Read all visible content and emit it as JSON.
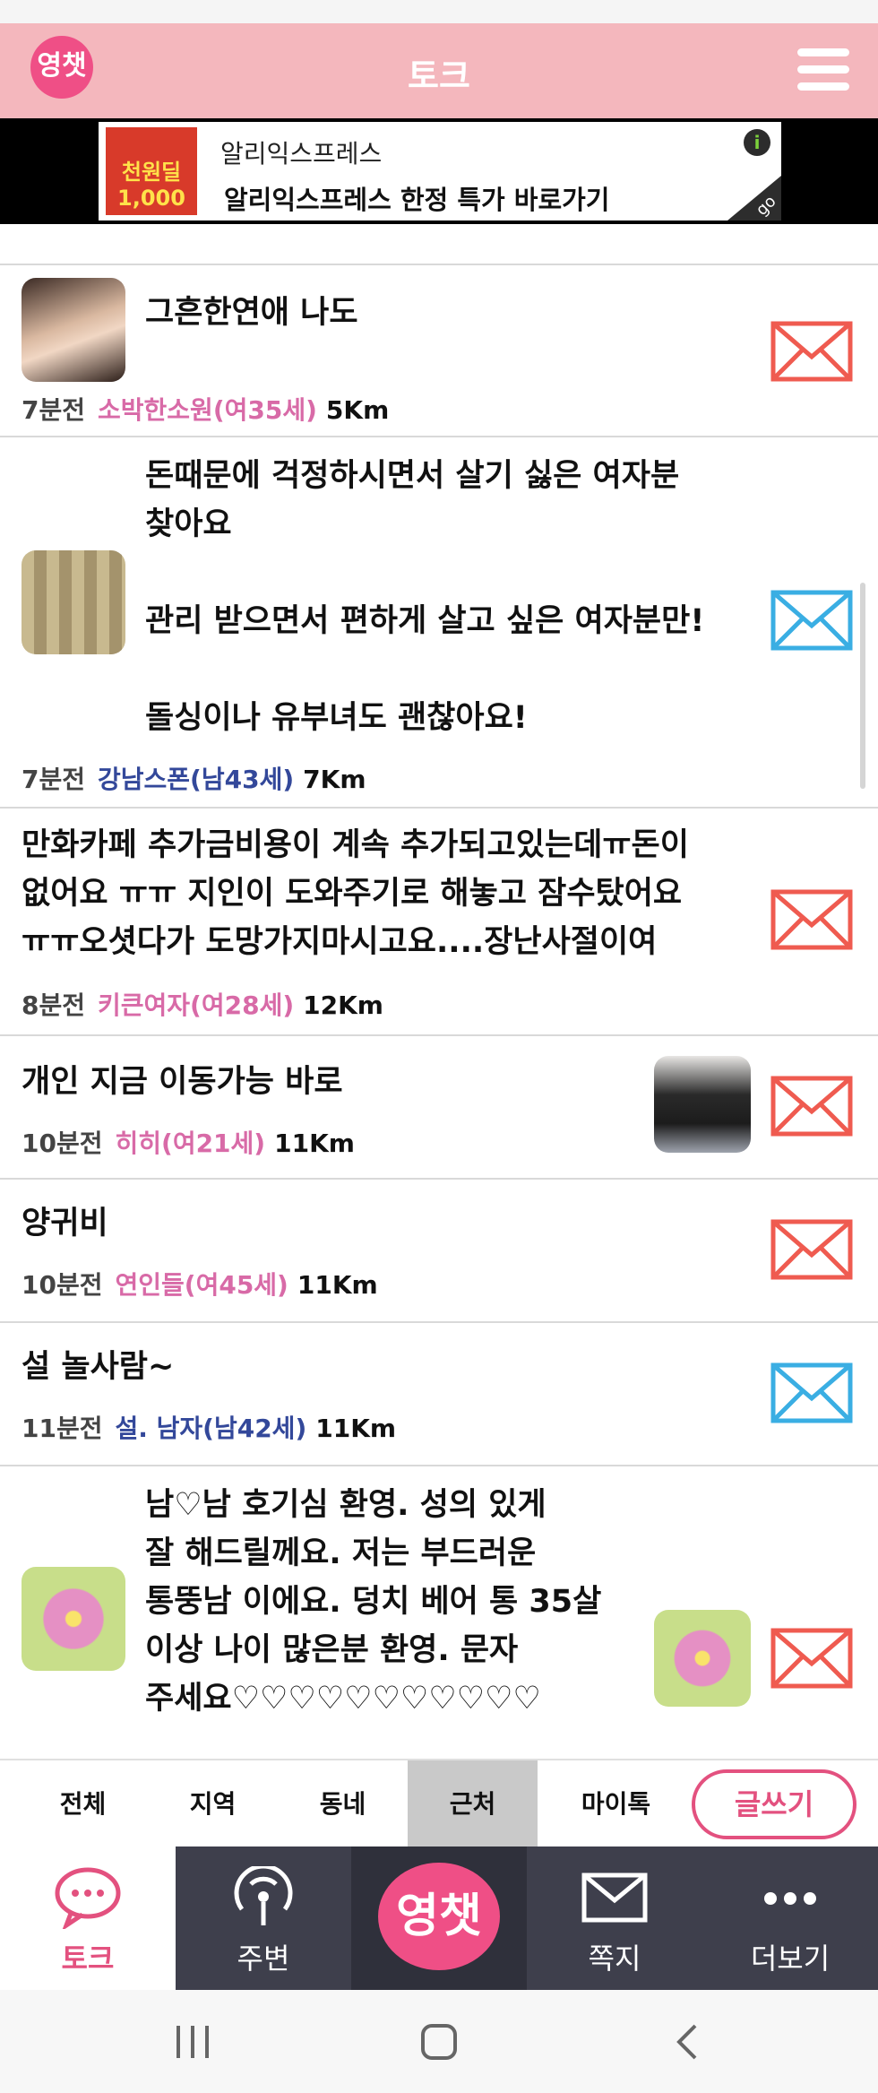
{
  "header": {
    "title": "토크",
    "logo_text": "영챗"
  },
  "ad": {
    "thumb_text": "천원딜 1,000",
    "title": "알리익스프레스",
    "subtitle": "알리익스프레스 한정 특가 바로가기",
    "info": "i",
    "go": "go"
  },
  "posts": [
    {
      "title": "그흔한연애 나도",
      "time": "7분전",
      "nickname": "소박한소원(여35세)",
      "distance": "5Km",
      "gender": "f",
      "mail_color": "#ef5b50"
    },
    {
      "title": "돈때문에 걱정하시면서 살기 싫은 여자분\n찾아요\n\n관리 받으면서 편하게 살고 싶은 여자분만!\n\n돌싱이나 유부녀도 괜찮아요!",
      "time": "7분전",
      "nickname": "강남스폰(남43세)",
      "distance": "7Km",
      "gender": "m",
      "mail_color": "#3aaee3"
    },
    {
      "title": "만화카페 추가금비용이 계속 추가되고있는데ㅠ돈이\n없어요 ㅠㅠ 지인이 도와주기로 해놓고 잠수탔어요\nㅠㅠ오셧다가 도망가지마시고요....장난사절이여",
      "time": "8분전",
      "nickname": "키큰여자(여28세)",
      "distance": "12Km",
      "gender": "f",
      "mail_color": "#ef5b50"
    },
    {
      "title": "개인 지금 이동가능 바로",
      "time": "10분전",
      "nickname": "히히(여21세)",
      "distance": "11Km",
      "gender": "f",
      "mail_color": "#ef5b50"
    },
    {
      "title": "양귀비",
      "time": "10분전",
      "nickname": "연인들(여45세)",
      "distance": "11Km",
      "gender": "f",
      "mail_color": "#ef5b50"
    },
    {
      "title": "설 놀사람~",
      "time": "11분전",
      "nickname": "설. 남자(남42세)",
      "distance": "11Km",
      "gender": "m",
      "mail_color": "#3aaee3"
    },
    {
      "title": "남♡남 호기심 환영. 성의 있게\n잘 해드릴께요. 저는 부드러운\n통뚱남 이에요. 덩치 베어 통 35살\n이상 나이 많은분 환영. 문자\n주세요♡♡♡♡♡♡♡♡♡♡♡",
      "gender": "m",
      "mail_color": "#ef5b50"
    }
  ],
  "filters": {
    "all": "전체",
    "region": "지역",
    "neighborhood": "동네",
    "nearby": "근처",
    "mytalk": "마이톡",
    "write": "글쓰기"
  },
  "nav": {
    "talk": "토크",
    "around": "주변",
    "logo": "영챗",
    "message": "쪽지",
    "more": "더보기"
  },
  "colors": {
    "accent": "#e3517f",
    "header_bg": "#f4b7bd",
    "nav_bg": "#3e3f4c"
  }
}
